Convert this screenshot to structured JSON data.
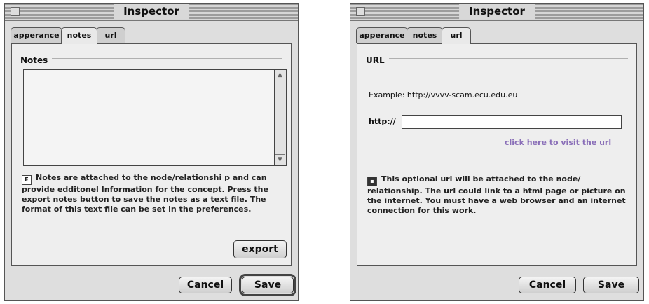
{
  "left": {
    "title": "Inspector",
    "tabs": [
      "apperance",
      "notes",
      "url"
    ],
    "active_tab": "notes",
    "section": "Notes",
    "help_text": "Notes are attached to the node/relationshi p and can provide edditonel Information for the concept. Press the export notes button to save the notes as a text file. The format of this text file can be set in the preferences.",
    "export_label": "export",
    "cancel_label": "Cancel",
    "save_label": "Save"
  },
  "right": {
    "title": "Inspector",
    "tabs": [
      "apperance",
      "notes",
      "url"
    ],
    "active_tab": "url",
    "section": "URL",
    "example": "Example: http://vvvv-scam.ecu.edu.eu",
    "prefix": "http://",
    "link_text": "click here to visit the url",
    "help_text": "This optional url will be attached to the node/ relationship. The url could link to a html page or picture on the internet. You must have a web browser and an internet connection for this work.",
    "cancel_label": "Cancel",
    "save_label": "Save"
  }
}
